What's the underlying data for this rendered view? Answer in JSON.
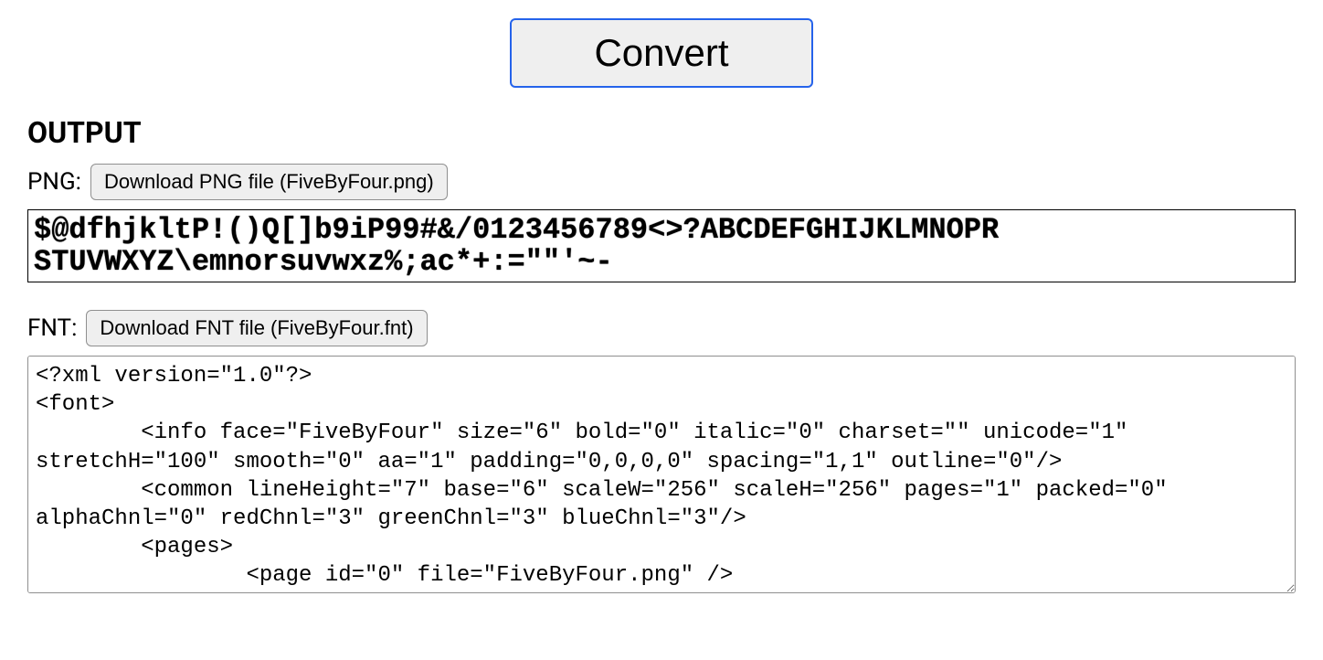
{
  "convert": {
    "label": "Convert"
  },
  "output": {
    "heading": "OUTPUT",
    "png": {
      "label": "PNG:",
      "download_label": "Download PNG file (FiveByFour.png)",
      "preview_line1": "$@dfhjkltP!()Q[]b9iP99#&/0123456789<>?ABCDEFGHIJKLMNOPR",
      "preview_line2": "STUVWXYZ\\emnorsuvwxz%;ac*+:=\"\"'~-"
    },
    "fnt": {
      "label": "FNT:",
      "download_label": "Download FNT file (FiveByFour.fnt)",
      "content": "<?xml version=\"1.0\"?>\n<font>\n        <info face=\"FiveByFour\" size=\"6\" bold=\"0\" italic=\"0\" charset=\"\" unicode=\"1\" stretchH=\"100\" smooth=\"0\" aa=\"1\" padding=\"0,0,0,0\" spacing=\"1,1\" outline=\"0\"/>\n        <common lineHeight=\"7\" base=\"6\" scaleW=\"256\" scaleH=\"256\" pages=\"1\" packed=\"0\" alphaChnl=\"0\" redChnl=\"3\" greenChnl=\"3\" blueChnl=\"3\"/>\n        <pages>\n                <page id=\"0\" file=\"FiveByFour.png\" />"
    }
  }
}
